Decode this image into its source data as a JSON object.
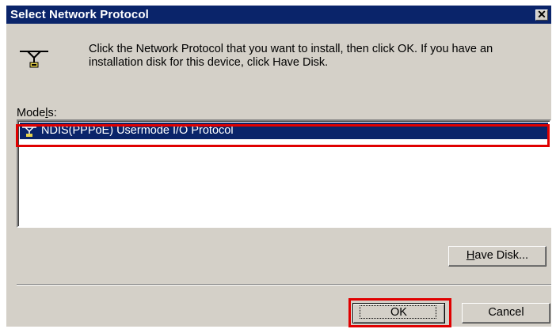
{
  "window": {
    "title": "Select Network Protocol",
    "close_glyph": "✕"
  },
  "instructions": "Click the Network Protocol that you want to install, then click OK. If you have an installation disk for this device, click Have Disk.",
  "models": {
    "label_pre": "Mode",
    "label_underlined": "l",
    "label_post": "s:",
    "items": [
      {
        "icon": "network-protocol-icon",
        "label": "NDIS(PPPoE) Usermode I/O Protocol",
        "selected": true
      }
    ]
  },
  "buttons": {
    "have_disk_underlined": "H",
    "have_disk_rest": "ave Disk...",
    "ok": "OK",
    "cancel": "Cancel"
  },
  "colors": {
    "titlebar": "#0a246a",
    "dialog_face": "#d4d0c8",
    "selection": "#0a246a",
    "annotation_highlight": "#e00000"
  }
}
